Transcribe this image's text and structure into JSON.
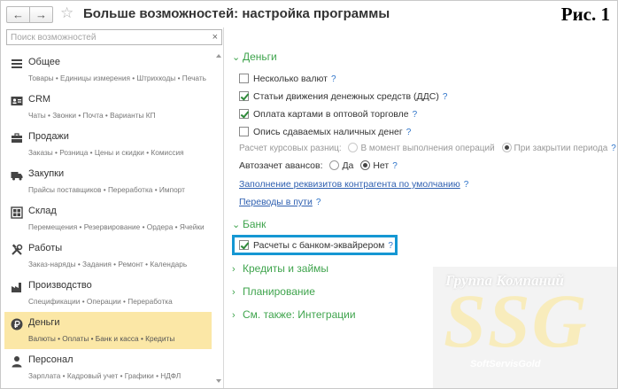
{
  "window": {
    "title": "Больше возможностей: настройка программы",
    "figure_label": "Рис. 1",
    "back_glyph": "←",
    "forward_glyph": "→",
    "star_glyph": "☆"
  },
  "search": {
    "placeholder": "Поиск возможностей",
    "clear_glyph": "×"
  },
  "sections": [
    {
      "title": "Общее",
      "subtitle": "Товары • Единицы измерения • Штрихкоды • Печать",
      "icon": "list-icon",
      "active": false
    },
    {
      "title": "CRM",
      "subtitle": "Чаты • Звонки • Почта • Варианты КП",
      "icon": "contact-card-icon",
      "active": false
    },
    {
      "title": "Продажи",
      "subtitle": "Заказы • Розница • Цены и скидки • Комиссия",
      "icon": "briefcase-icon",
      "active": false
    },
    {
      "title": "Закупки",
      "subtitle": "Прайсы поставщиков • Переработка • Импорт",
      "icon": "truck-icon",
      "active": false
    },
    {
      "title": "Склад",
      "subtitle": "Перемещения • Резервирование • Ордера • Ячейки",
      "icon": "warehouse-icon",
      "active": false
    },
    {
      "title": "Работы",
      "subtitle": "Заказ-наряды • Задания • Ремонт • Календарь",
      "icon": "tools-icon",
      "active": false
    },
    {
      "title": "Производство",
      "subtitle": "Спецификации • Операции • Переработка",
      "icon": "factory-icon",
      "active": false
    },
    {
      "title": "Деньги",
      "subtitle": "Валюты • Оплаты • Банк и касса • Кредиты",
      "icon": "ruble-icon",
      "active": true
    },
    {
      "title": "Персонал",
      "subtitle": "Зарплата • Кадровый учет • Графики • НДФЛ",
      "icon": "person-icon",
      "active": false
    }
  ],
  "money": {
    "header": "Деньги",
    "multi_currency": "Несколько валют",
    "cash_flow_items": "Статьи движения денежных средств (ДДС)",
    "card_payments": "Оплата картами в оптовой торговле",
    "cash_inventory": "Опись сдаваемых наличных денег",
    "rate_diff_label": "Расчет курсовых разниц:",
    "rate_diff_opt1": "В момент выполнения операций",
    "rate_diff_opt2": "При закрытии периода",
    "auto_offset_label": "Автозачет авансов:",
    "auto_offset_yes": "Да",
    "auto_offset_no": "Нет",
    "fill_details_link": "Заполнение реквизитов контрагента по умолчанию",
    "transit_link": "Переводы в пути",
    "help": "?"
  },
  "bank": {
    "header": "Банк",
    "acquirer": "Расчеты с банком-эквайрером"
  },
  "collapsed_groups": [
    "Кредиты и займы",
    "Планирование",
    "См. также: Интеграции"
  ],
  "watermark": {
    "top": "Группа Компаний",
    "big": "SSG",
    "sub": "SoftServisGold"
  },
  "glyphs": {
    "chevron_down": "⌄",
    "chevron_right": "›"
  },
  "colors": {
    "group_green": "#3fa44d",
    "active_section": "#fbe7a6",
    "highlight_border": "#1597d3",
    "link": "#2e5fb0",
    "help": "#2e74c9"
  }
}
